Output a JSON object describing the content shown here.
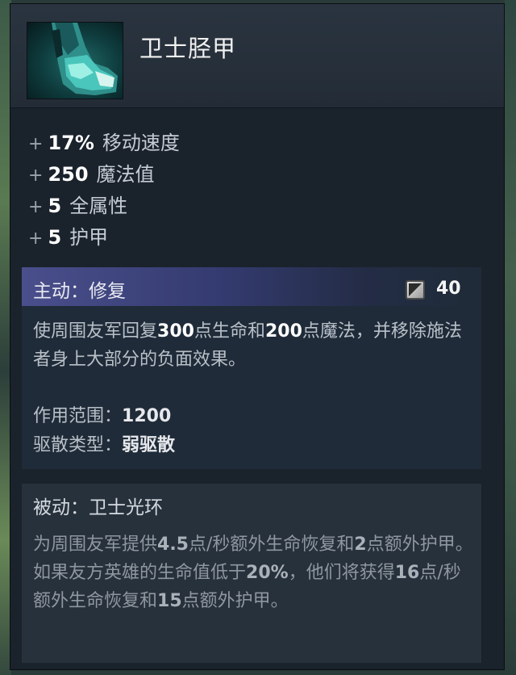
{
  "item": {
    "name": "卫士胫甲"
  },
  "stats": [
    {
      "sign": "+",
      "value": "17%",
      "label": "移动速度"
    },
    {
      "sign": "+",
      "value": "250",
      "label": "魔法值"
    },
    {
      "sign": "+",
      "value": "5",
      "label": "全属性"
    },
    {
      "sign": "+",
      "value": "5",
      "label": "护甲"
    }
  ],
  "active": {
    "title": "主动：修复",
    "cooldown": "40",
    "desc": [
      "使周围友军回复",
      "300",
      "点生命和",
      "200",
      "点魔法，并移除施法者身上大部分的负面效果。"
    ],
    "range_label": "作用范围：",
    "range_value": "1200",
    "dispel_label": "驱散类型：",
    "dispel_value": "弱驱散"
  },
  "passive": {
    "title": "被动：卫士光环",
    "desc": [
      "为周围友军提供",
      "4.5",
      "点/秒额外生命恢复和",
      "2",
      "点额外护甲。如果友方英雄的生命值低于",
      "20%",
      "，他们将获得",
      "16",
      "点/秒额外生命恢复和",
      "15",
      "点额外护甲。"
    ]
  },
  "colors": {
    "tooltip_bg": "#1a222c",
    "active_header": "#4a4f8c",
    "highlight": "#ffffff"
  }
}
